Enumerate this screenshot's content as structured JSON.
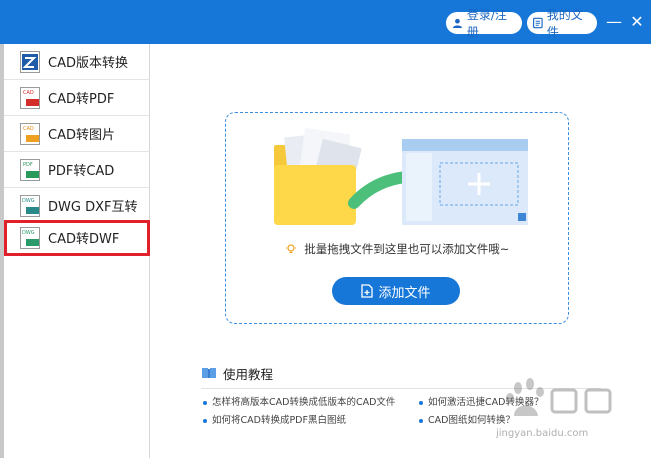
{
  "titlebar": {
    "login_label": "登录/注册",
    "files_label": "我的文件",
    "minimize_glyph": "—",
    "close_glyph": "✕",
    "bg_color": "#1677d8"
  },
  "sidebar": {
    "items": [
      {
        "label": "CAD版本转换",
        "icon": "cad-version-icon",
        "active": false
      },
      {
        "label": "CAD转PDF",
        "icon": "cad-to-pdf-icon",
        "active": false
      },
      {
        "label": "CAD转图片",
        "icon": "cad-to-image-icon",
        "active": false
      },
      {
        "label": "PDF转CAD",
        "icon": "pdf-to-cad-icon",
        "active": false
      },
      {
        "label": "DWG DXF互转",
        "icon": "dwg-dxf-icon",
        "active": false
      },
      {
        "label": "CAD转DWF",
        "icon": "cad-to-dwf-icon",
        "active": true
      }
    ],
    "highlight_color": "#e0202a"
  },
  "main": {
    "drop_hint": "批量拖拽文件到这里也可以添加文件哦~",
    "add_file_label": "添加文件"
  },
  "tutorial": {
    "title": "使用教程",
    "links": [
      "怎样将高版本CAD转换成低版本的CAD文件",
      "如何激活迅捷CAD转换器？",
      "如何将CAD转换成PDF黑白图纸",
      "CAD图纸如何转换？"
    ]
  },
  "watermark": {
    "text": "jingyan.baidu.com"
  }
}
